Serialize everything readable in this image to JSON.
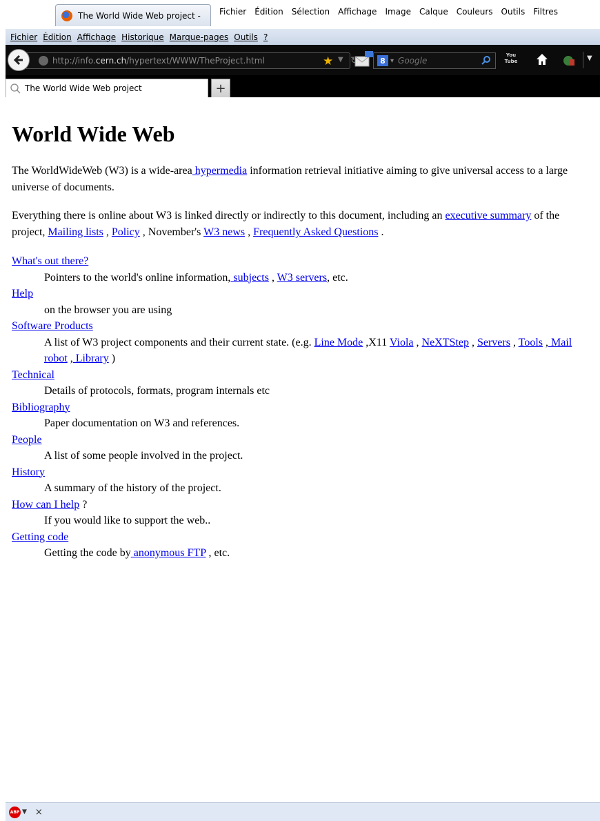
{
  "outer": {
    "firefox_tab_title": "The World Wide Web project -",
    "gimp_menu": [
      "Fichier",
      "Édition",
      "Sélection",
      "Affichage",
      "Image",
      "Calque",
      "Couleurs",
      "Outils",
      "Filtres"
    ]
  },
  "menubar": {
    "items": [
      "Fichier",
      "Édition",
      "Affichage",
      "Historique",
      "Marque-pages",
      "Outils",
      "?"
    ]
  },
  "navbar": {
    "url_prefix": "http://info.",
    "url_domain": "cern.ch",
    "url_path": "/hypertext/WWW/TheProject.html",
    "search_placeholder": "Google",
    "search_engine_label": "8",
    "youtube_label_top": "You",
    "youtube_label_bottom": "Tube"
  },
  "tabs": [
    {
      "label": "The World Wide Web project"
    }
  ],
  "page": {
    "title": "World Wide Web",
    "para1": {
      "before": "The WorldWideWeb (W3) is a wide-area",
      "link": " hypermedia",
      "after": " information retrieval initiative aiming to give universal access to a large universe of documents."
    },
    "para2": {
      "t1": "Everything there is online about W3 is linked directly or indirectly to this document, including an ",
      "l1": "executive summary",
      "t2": " of the project, ",
      "l2": "Mailing lists",
      "t3": " , ",
      "l3": "Policy",
      "t4": " , November's ",
      "l4": "W3 news",
      "t5": " , ",
      "l5": "Frequently Asked Questions",
      "t6": " ."
    },
    "entries": {
      "whats_out_there": {
        "term": "What's out there?",
        "d1": "Pointers to the world's online information,",
        "l1": " subjects",
        "d2": " , ",
        "l2": "W3 servers",
        "d3": ", etc."
      },
      "help": {
        "term": "Help",
        "desc": "on the browser you are using"
      },
      "software": {
        "term": "Software Products",
        "d1": "A list of W3 project components and their current state. (e.g. ",
        "l1": "Line Mode",
        "d2": " ,X11 ",
        "l2": "Viola",
        "d3": " , ",
        "l3": "NeXTStep",
        "d4": " , ",
        "l4": "Servers",
        "d5": " , ",
        "l5": "Tools",
        "d6": " ,",
        "l6": " Mail robot",
        "d7": " ,",
        "l7": " Library",
        "d8": " )"
      },
      "technical": {
        "term": "Technical",
        "desc": "Details of protocols, formats, program internals etc"
      },
      "bibliography": {
        "term": "Bibliography",
        "desc": "Paper documentation on W3 and references."
      },
      "people": {
        "term": "People",
        "desc": "A list of some people involved in the project."
      },
      "history": {
        "term": "History",
        "desc": "A summary of the history of the project."
      },
      "how_help": {
        "term": "How can I help",
        "after": " ?",
        "desc": "If you would like to support the web.."
      },
      "getting_code": {
        "term": "Getting code",
        "d1": "Getting the code by",
        "l1": " anonymous FTP",
        "d2": " , etc."
      }
    }
  },
  "statusbar": {
    "abp_label": "ABP",
    "close_label": "×"
  }
}
